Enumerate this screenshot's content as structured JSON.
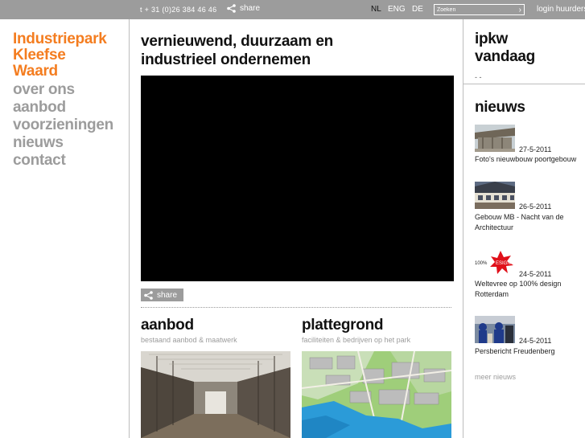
{
  "topbar": {
    "phone": "t + 31 (0)26 384 46 46",
    "share_label": "share",
    "languages": [
      "NL",
      "ENG",
      "DE"
    ],
    "active_language": "NL",
    "search_placeholder": "Zoeken",
    "login_label": "login huurders"
  },
  "logo": {
    "line1": "Industriepark",
    "line2": "Kleefse",
    "line3": "Waard"
  },
  "nav": [
    "over ons",
    "aanbod",
    "voorzieningen",
    "nieuws",
    "contact"
  ],
  "main": {
    "headline_line1": "vernieuwend, duurzaam en",
    "headline_line2": "industrieel ondernemen",
    "share_label": "share",
    "aanbod": {
      "title": "aanbod",
      "subtitle": "bestaand aanbod & maatwerk"
    },
    "plattegrond": {
      "title": "plattegrond",
      "subtitle": "faciliteiten & bedrijven op het park"
    }
  },
  "right": {
    "today_line1": "ipkw",
    "today_line2": "vandaag",
    "today_text": "- -",
    "news_title": "nieuws",
    "news": [
      {
        "date": "27-5-2011",
        "line1": "Foto's nieuwbouw poortgebouw",
        "line2": ""
      },
      {
        "date": "26-5-2011",
        "line1": "Gebouw MB - Nacht van de",
        "line2": "Architectuur"
      },
      {
        "date": "24-5-2011",
        "line1": "Weltevree op 100% design",
        "line2": "Rotterdam"
      },
      {
        "date": "24-5-2011",
        "line1": "Persbericht Freudenberg",
        "line2": ""
      }
    ],
    "more_news": "meer nieuws"
  },
  "colors": {
    "brand_orange": "#f47d20",
    "gray": "#9c9c9c",
    "video_bg": "#000000"
  }
}
